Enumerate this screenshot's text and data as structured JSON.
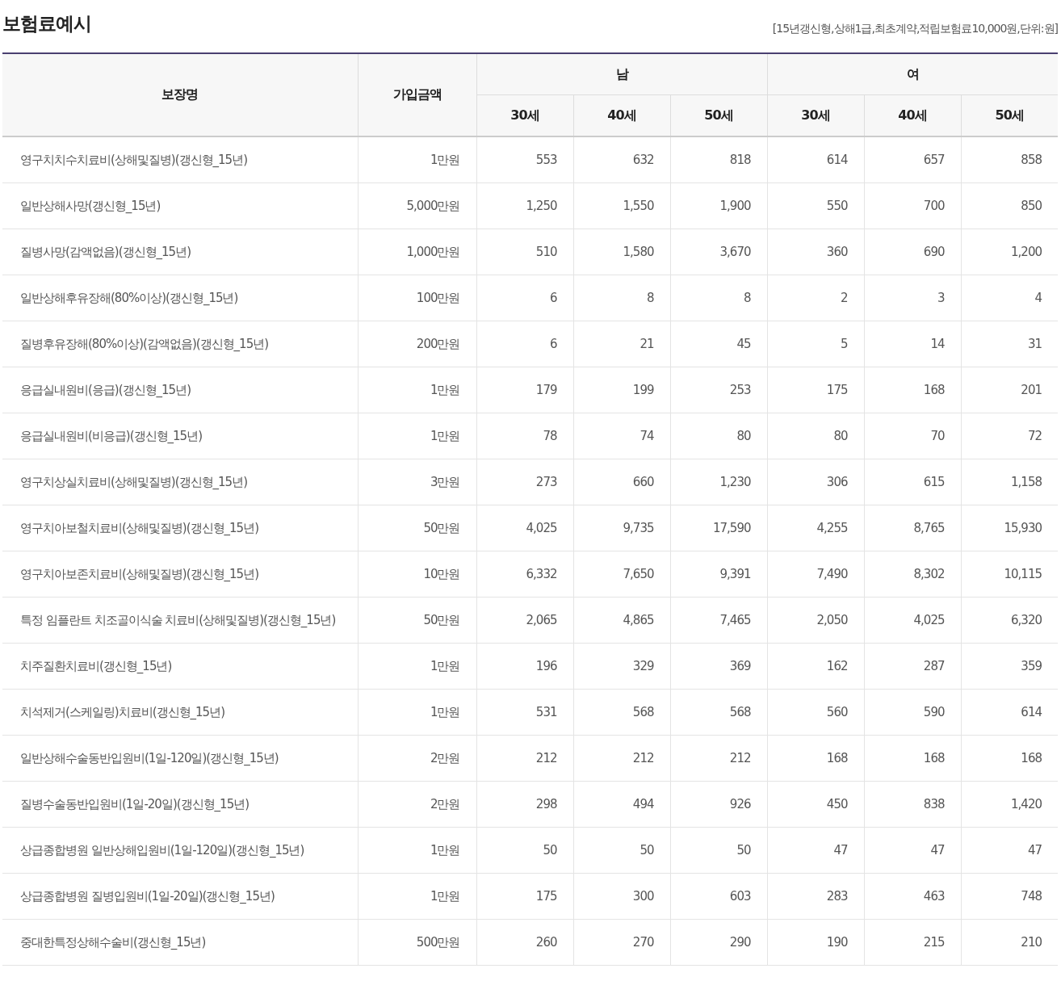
{
  "title": "보험료예시",
  "note": "[15년갱신형,상해1급,최초계약,적립보험료10,000원,단위:원]",
  "table": {
    "name_column": "보장명",
    "amount_column": "가입금액",
    "groups": [
      {
        "label": "남",
        "ages": [
          "30세",
          "40세",
          "50세"
        ]
      },
      {
        "label": "여",
        "ages": [
          "30세",
          "40세",
          "50세"
        ]
      }
    ],
    "rows": [
      {
        "name": "영구치치수치료비(상해및질병)(갱신형_15년)",
        "amount": "1만원",
        "values": [
          "553",
          "632",
          "818",
          "614",
          "657",
          "858"
        ]
      },
      {
        "name": "일반상해사망(갱신형_15년)",
        "amount": "5,000만원",
        "values": [
          "1,250",
          "1,550",
          "1,900",
          "550",
          "700",
          "850"
        ]
      },
      {
        "name": "질병사망(감액없음)(갱신형_15년)",
        "amount": "1,000만원",
        "values": [
          "510",
          "1,580",
          "3,670",
          "360",
          "690",
          "1,200"
        ]
      },
      {
        "name": "일반상해후유장해(80%이상)(갱신형_15년)",
        "amount": "100만원",
        "values": [
          "6",
          "8",
          "8",
          "2",
          "3",
          "4"
        ]
      },
      {
        "name": "질병후유장해(80%이상)(감액없음)(갱신형_15년)",
        "amount": "200만원",
        "values": [
          "6",
          "21",
          "45",
          "5",
          "14",
          "31"
        ]
      },
      {
        "name": "응급실내원비(응급)(갱신형_15년)",
        "amount": "1만원",
        "values": [
          "179",
          "199",
          "253",
          "175",
          "168",
          "201"
        ]
      },
      {
        "name": "응급실내원비(비응급)(갱신형_15년)",
        "amount": "1만원",
        "values": [
          "78",
          "74",
          "80",
          "80",
          "70",
          "72"
        ]
      },
      {
        "name": "영구치상실치료비(상해및질병)(갱신형_15년)",
        "amount": "3만원",
        "values": [
          "273",
          "660",
          "1,230",
          "306",
          "615",
          "1,158"
        ]
      },
      {
        "name": "영구치아보철치료비(상해및질병)(갱신형_15년)",
        "amount": "50만원",
        "values": [
          "4,025",
          "9,735",
          "17,590",
          "4,255",
          "8,765",
          "15,930"
        ]
      },
      {
        "name": "영구치아보존치료비(상해및질병)(갱신형_15년)",
        "amount": "10만원",
        "values": [
          "6,332",
          "7,650",
          "9,391",
          "7,490",
          "8,302",
          "10,115"
        ]
      },
      {
        "name": "특정 임플란트 치조골이식술 치료비(상해및질병)(갱신형_15년)",
        "amount": "50만원",
        "values": [
          "2,065",
          "4,865",
          "7,465",
          "2,050",
          "4,025",
          "6,320"
        ]
      },
      {
        "name": "치주질환치료비(갱신형_15년)",
        "amount": "1만원",
        "values": [
          "196",
          "329",
          "369",
          "162",
          "287",
          "359"
        ]
      },
      {
        "name": "치석제거(스케일링)치료비(갱신형_15년)",
        "amount": "1만원",
        "values": [
          "531",
          "568",
          "568",
          "560",
          "590",
          "614"
        ]
      },
      {
        "name": "일반상해수술동반입원비(1일-120일)(갱신형_15년)",
        "amount": "2만원",
        "values": [
          "212",
          "212",
          "212",
          "168",
          "168",
          "168"
        ]
      },
      {
        "name": "질병수술동반입원비(1일-20일)(갱신형_15년)",
        "amount": "2만원",
        "values": [
          "298",
          "494",
          "926",
          "450",
          "838",
          "1,420"
        ]
      },
      {
        "name": "상급종합병원 일반상해입원비(1일-120일)(갱신형_15년)",
        "amount": "1만원",
        "values": [
          "50",
          "50",
          "50",
          "47",
          "47",
          "47"
        ]
      },
      {
        "name": "상급종합병원 질병입원비(1일-20일)(갱신형_15년)",
        "amount": "1만원",
        "values": [
          "175",
          "300",
          "603",
          "283",
          "463",
          "748"
        ]
      },
      {
        "name": "중대한특정상해수술비(갱신형_15년)",
        "amount": "500만원",
        "values": [
          "260",
          "270",
          "290",
          "190",
          "215",
          "210"
        ]
      }
    ]
  }
}
